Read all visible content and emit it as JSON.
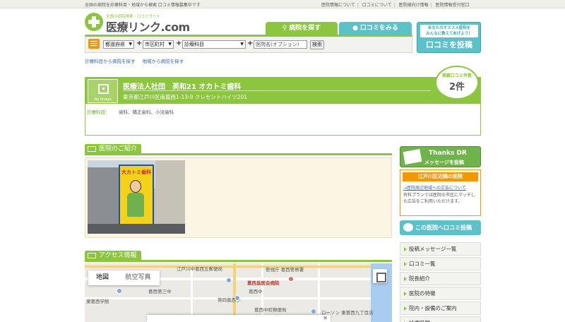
{
  "topbar": {
    "tagline": "全国の病院を診療科目・地域から検索 口コミ情報募集中です",
    "links": [
      "医院情報について",
      "口コミについて",
      "医院様向け情報",
      "医院情報受付窓口"
    ]
  },
  "logo": {
    "sub": "全国の病院検索・口コミサイト",
    "main": "医療リンク.com"
  },
  "tabs": {
    "search": "病院を探す",
    "review": "口コミをみる"
  },
  "post_button": {
    "small_line1": "あなたのオススメ医院を",
    "small_line2": "みんなに教えてあげよう！",
    "big": "口コミを投稿"
  },
  "search": {
    "prefecture": "都道府県",
    "city": "市区町村",
    "department": "診療科目",
    "name_placeholder": "医院名(オプション)",
    "button": "検索"
  },
  "sublinks": [
    "診療科目から病院を探す",
    "地域から病院を探す"
  ],
  "clinic": {
    "no_image": "No Image",
    "name": "医療法人社団　英和21 オカトミ歯科",
    "address": "東京都江戸川区南葛西1-13-9 クレセントハイツ201",
    "dept_label": "診療科目：",
    "dept_value": "歯科、矯正歯科、小児歯科"
  },
  "badge": {
    "title": "掲載口コミ件数",
    "count": "2件"
  },
  "sections": {
    "intro": "医院のご紹介",
    "access": "アクセス情報"
  },
  "photo": {
    "sign_text": "大カトミ歯科"
  },
  "map": {
    "map_label": "地図",
    "satellite_label": "航空写真",
    "labels": {
      "a": "江戸川中葛西五郵便局",
      "b": "警視庁 葛西警察署",
      "c": "葛西昌医会病院",
      "d": "葛西第三中",
      "e": "葛西中",
      "f": "葛西小",
      "g": "第四葛西小",
      "h": "葛西中町郵便局",
      "i": "ローソン 東葛西九丁目店",
      "j": "東葛西学館"
    }
  },
  "sidebar": {
    "thanks_line1": "Thanks DR",
    "thanks_line2": "メッセージを投稿",
    "ad_header": "江戸川区近隣の医院",
    "ad_link": "→医院周辺地域への広告について",
    "ad_desc": "有料プランでは医院の市区にマッチした広告をご利用いただけます。",
    "review_button": "この医院へ口コミ投稿",
    "menu": [
      "投稿メッセージ一覧",
      "口コミ一覧",
      "院長紹介",
      "医院の特徴",
      "院内・設備のご案内",
      "診療時間"
    ]
  }
}
